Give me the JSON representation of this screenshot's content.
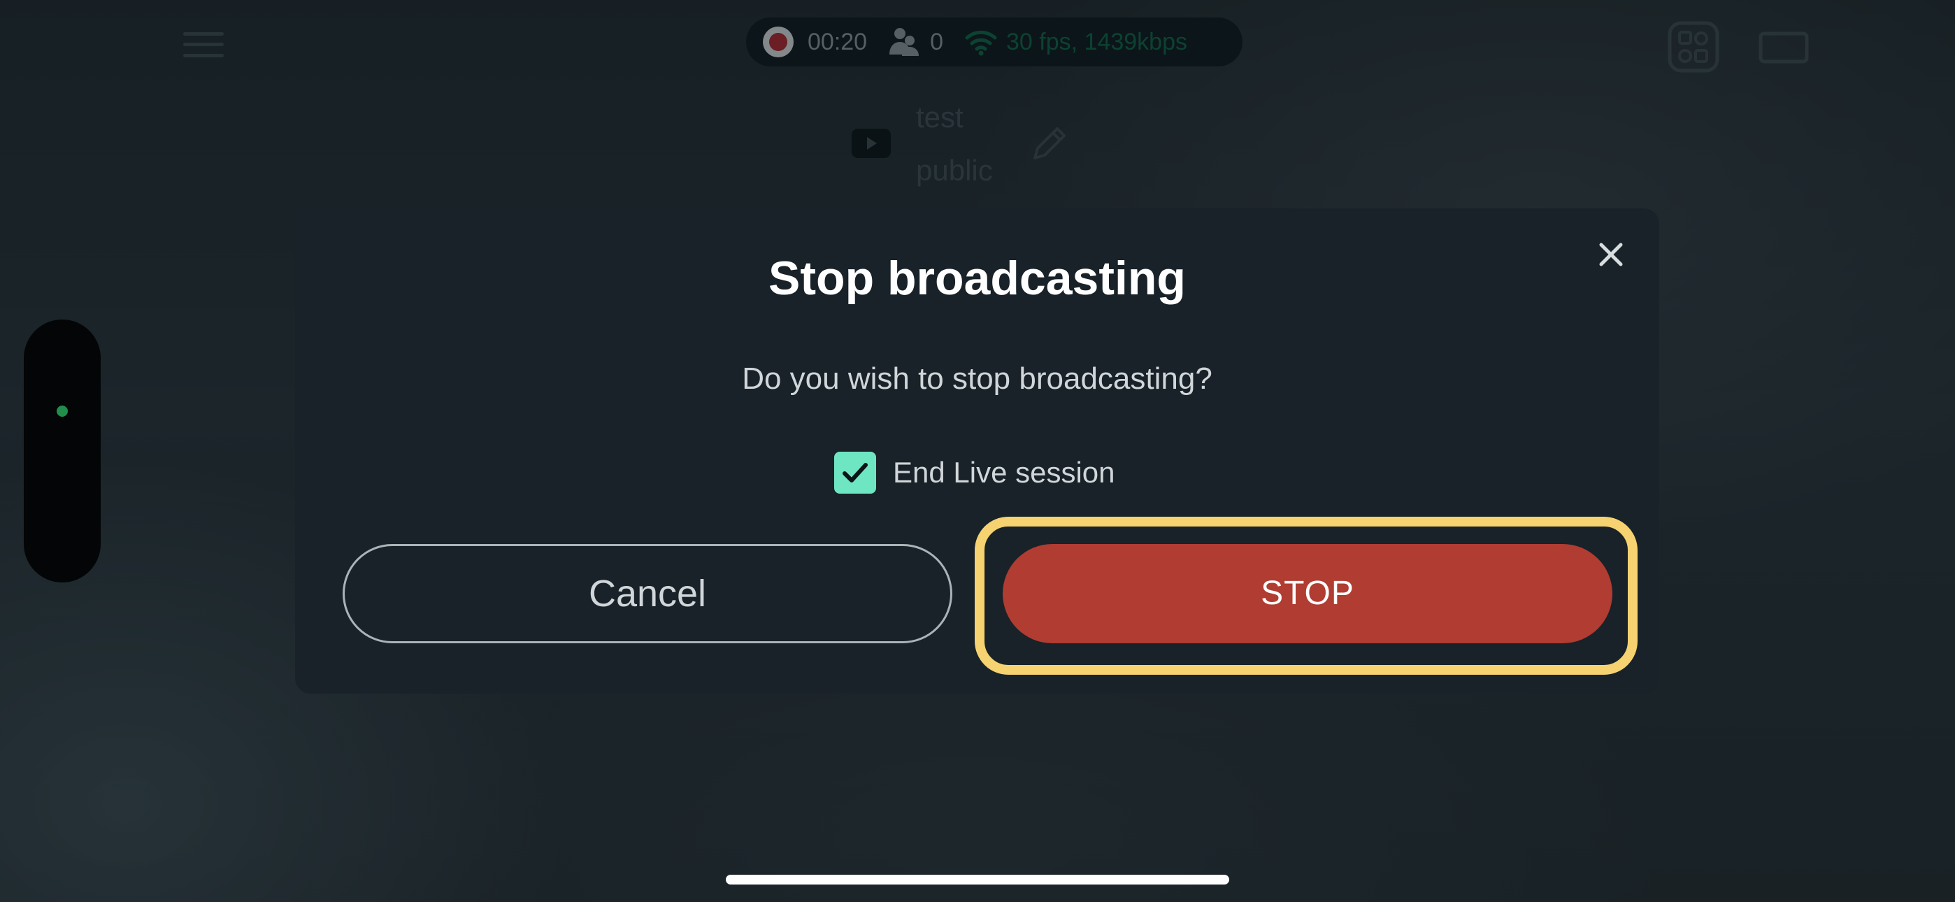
{
  "status_bar": {
    "elapsed": "00:20",
    "viewers": "0",
    "stream_quality": "30 fps, 1439kbps"
  },
  "stream_info": {
    "platform_icon": "youtube-icon",
    "title": "test",
    "privacy": "public"
  },
  "dialog": {
    "title": "Stop broadcasting",
    "message": "Do you wish to stop broadcasting?",
    "checkbox_label": "End Live session",
    "checkbox_checked": true,
    "cancel_label": "Cancel",
    "stop_label": "STOP"
  },
  "colors": {
    "stop_button": "#b03c32",
    "highlight": "#f6d270",
    "checkbox": "#6ee6c2",
    "live_dot": "#2fd36a"
  }
}
